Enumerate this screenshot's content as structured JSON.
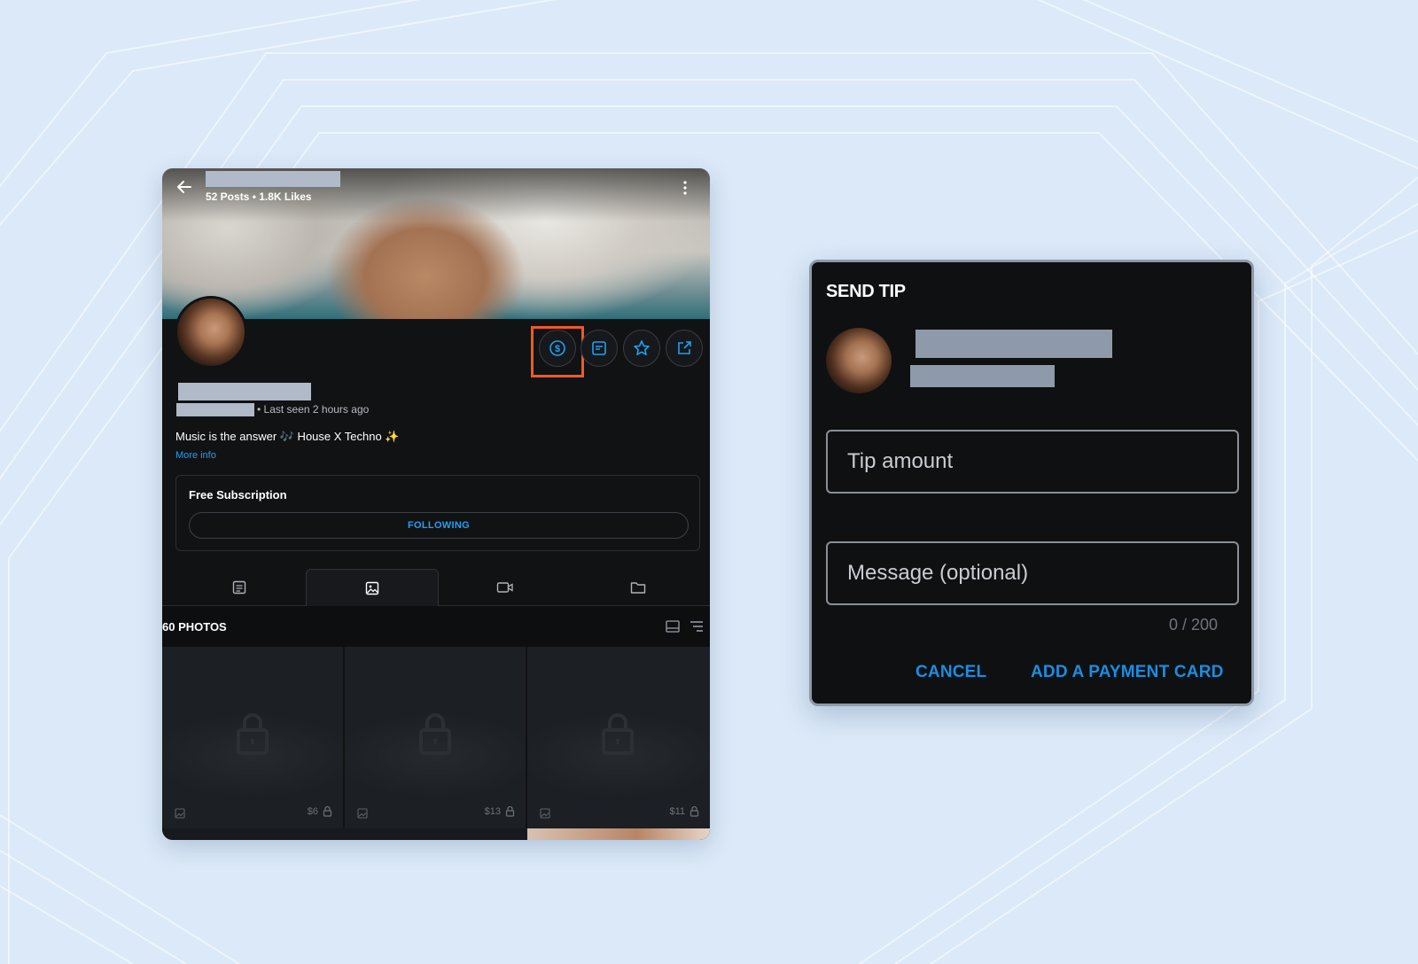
{
  "profile": {
    "stats": "52 Posts • 1.8K Likes",
    "last_seen": "• Last seen 2 hours ago",
    "bio": "Music is the answer 🎶 House X Techno ✨",
    "more_info": "More info",
    "subscription_title": "Free Subscription",
    "following_label": "FOLLOWING",
    "photos_title": "60 PHOTOS",
    "tiles": [
      {
        "price": "$6"
      },
      {
        "price": "$13"
      },
      {
        "price": "$11"
      }
    ]
  },
  "tip_dialog": {
    "title": "SEND TIP",
    "tip_amount_placeholder": "Tip amount",
    "message_placeholder": "Message (optional)",
    "counter": "0 / 200",
    "cancel_label": "CANCEL",
    "add_card_label": "ADD A PAYMENT CARD"
  },
  "colors": {
    "accent_blue": "#1da1f2",
    "highlight_orange": "#f05a24",
    "panel_dark": "#111214"
  }
}
